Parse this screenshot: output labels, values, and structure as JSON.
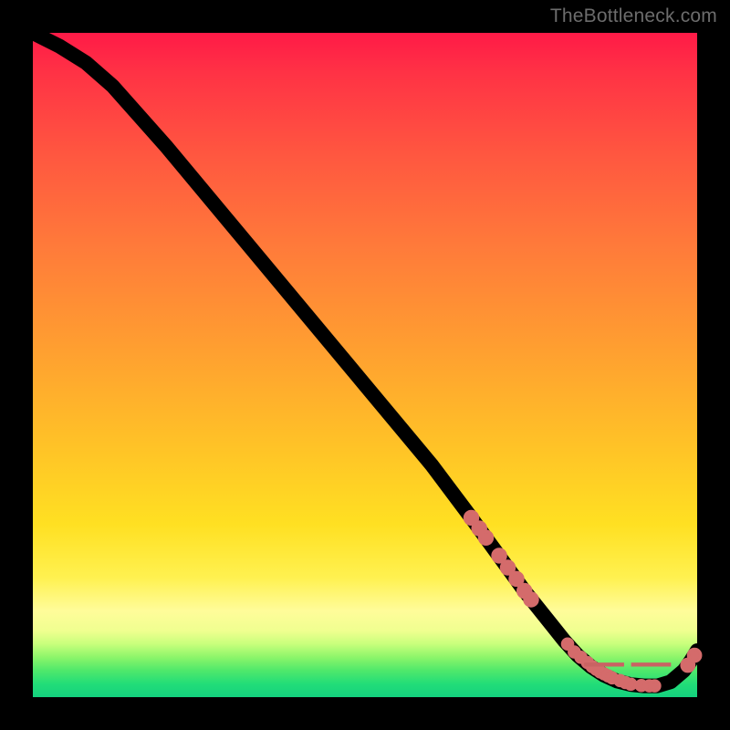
{
  "watermark": "TheBottleneck.com",
  "chart_data": {
    "type": "line",
    "title": "",
    "xlabel": "",
    "ylabel": "",
    "xlim": [
      0,
      100
    ],
    "ylim": [
      0,
      100
    ],
    "grid": false,
    "legend": false,
    "series": [
      {
        "name": "bottleneck-curve",
        "x": [
          0,
          4,
          8,
          12,
          20,
          30,
          40,
          50,
          60,
          66,
          70,
          74,
          78,
          80,
          82,
          84,
          86,
          88,
          90,
          92,
          94,
          96,
          98,
          99,
          100
        ],
        "y": [
          100,
          98,
          95.5,
          92,
          83,
          71,
          59,
          47,
          35,
          27,
          21.5,
          16,
          11,
          8.5,
          6.3,
          4.6,
          3.3,
          2.4,
          1.9,
          1.7,
          1.7,
          2.3,
          4.0,
          5.4,
          7.0
        ]
      }
    ],
    "markers_descending": {
      "name": "highlighted-points-descending",
      "x": [
        66,
        67.2,
        68.2,
        70.2,
        71.5,
        72.8,
        74,
        75
      ],
      "y": [
        27,
        25.4,
        24,
        21.3,
        19.5,
        17.8,
        16,
        14.7
      ]
    },
    "markers_flat": {
      "name": "highlighted-points-flat",
      "x": [
        80.5,
        81.5,
        82.5,
        83.5,
        84.2,
        84.8,
        85.4,
        86.0,
        86.6,
        87.2,
        88.4,
        89.2,
        90.0,
        91.6,
        92.8,
        93.6
      ],
      "y": [
        8.0,
        6.8,
        6.0,
        5.2,
        4.6,
        4.2,
        3.8,
        3.5,
        3.2,
        2.9,
        2.5,
        2.2,
        1.95,
        1.75,
        1.7,
        1.7
      ]
    },
    "tail_markers": {
      "name": "highlighted-points-tail",
      "x": [
        98.6,
        99.6
      ],
      "y": [
        4.8,
        6.3
      ]
    },
    "flat_label_text": "— —"
  }
}
